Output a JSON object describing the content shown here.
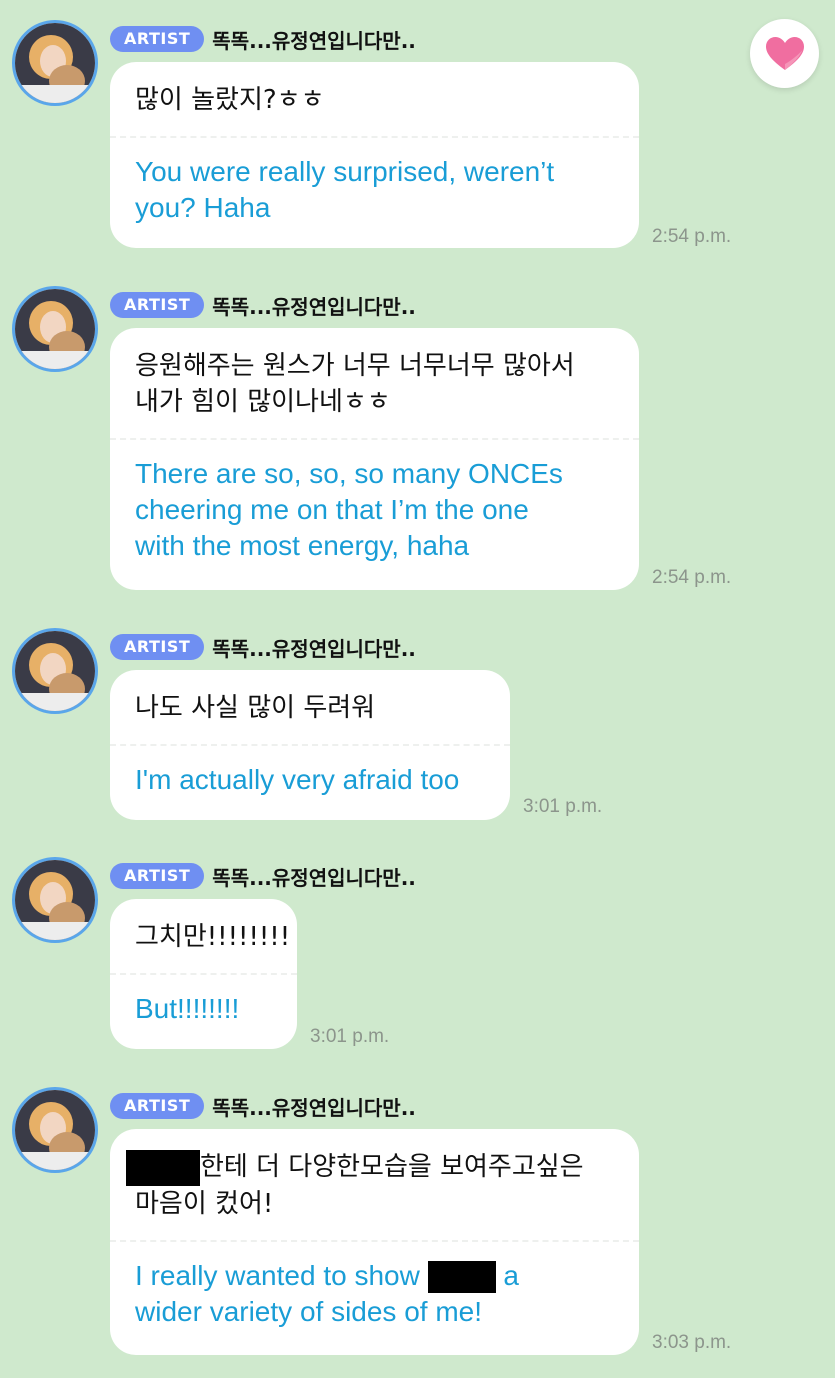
{
  "badge_label": "ARTIST",
  "sender_name": "똑똑...유정연입니다만..",
  "messages": [
    {
      "korean": [
        "많이 놀랐지?ㅎㅎ"
      ],
      "english": [
        "You were really surprised, weren’t",
        "you? Haha"
      ],
      "time": "2:54 p.m."
    },
    {
      "korean": [
        "응원해주는 원스가 너무 너무너무 많아서",
        "내가 힘이 많이나네ㅎㅎ"
      ],
      "english": [
        "There are so, so, so many ONCEs",
        "cheering me on that I’m the one",
        "with the most energy, haha"
      ],
      "time": "2:54 p.m."
    },
    {
      "korean": [
        "나도 사실 많이 두려워"
      ],
      "english": [
        "I'm actually very afraid too"
      ],
      "time": "3:01 p.m."
    },
    {
      "korean": [
        "그치만!!!!!!!!"
      ],
      "english": [
        "But!!!!!!!!"
      ],
      "time": "3:01 p.m."
    },
    {
      "korean": [
        "한테 더 다양한모습을 보여주고싶은",
        "마음이 컸어!"
      ],
      "english": [
        "I really wanted to show",
        "a",
        "wider variety of sides of me!"
      ],
      "time": "3:03 p.m."
    }
  ],
  "icons": {
    "heart_button": "heart-icon",
    "avatar": "artist-avatar"
  },
  "colors": {
    "background": "#cfe9cd",
    "badge": "#6f8ff2",
    "translation_text": "#199dd6",
    "heart": "#f06ea0"
  }
}
